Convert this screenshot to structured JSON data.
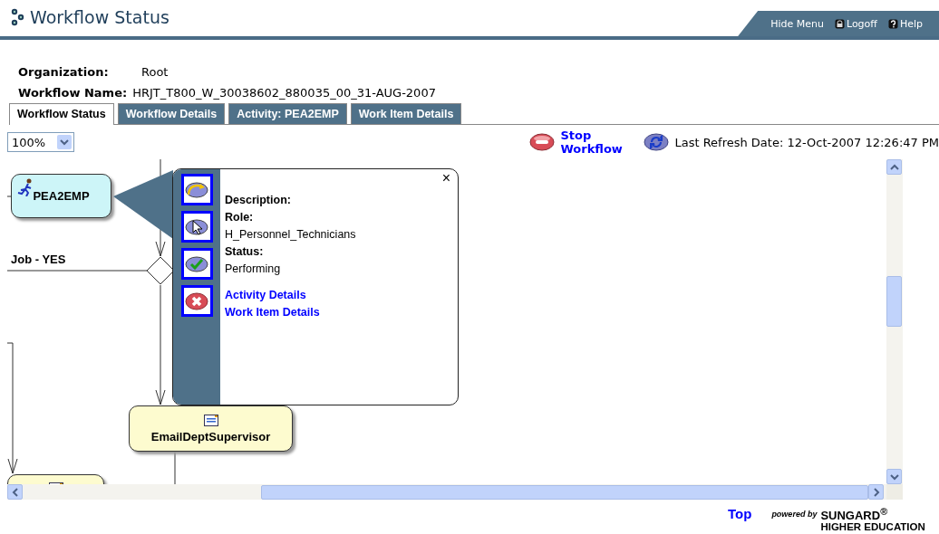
{
  "header": {
    "title": "Workflow Status",
    "nav": [
      {
        "label": "Hide Menu"
      },
      {
        "label": "Logoff",
        "kind": "lock"
      },
      {
        "label": "Help",
        "kind": "help"
      }
    ]
  },
  "info": [
    {
      "label": "Organization:",
      "value": "Root"
    },
    {
      "label": "Workflow Name:",
      "value": "HRJT_T800_W_30038602_880035_00_31-AUG-2007"
    }
  ],
  "tabs": [
    {
      "label": "Workflow Status",
      "selected": true
    },
    {
      "label": "Workflow Details",
      "selected": false
    },
    {
      "label": "Activity: PEA2EMP",
      "selected": false
    },
    {
      "label": "Work Item Details",
      "selected": false
    }
  ],
  "toolbar": {
    "zoom": "100%",
    "stop_label": "Stop Workflow",
    "refresh_label": "Last Refresh Date: 12-Oct-2007 12:26:47 PM"
  },
  "diagram": {
    "nodes": [
      {
        "label": "PEA2EMP",
        "kind": "activity"
      },
      {
        "label": "EmailDeptSupervisor",
        "kind": "email"
      },
      {
        "kind": "email"
      }
    ],
    "edge_label": "Job - YES",
    "popup": {
      "close": "×",
      "actions": [
        {
          "kind": "forward"
        },
        {
          "kind": "select"
        },
        {
          "kind": "complete"
        },
        {
          "kind": "cancel"
        }
      ],
      "fields": [
        {
          "label": "Description:"
        },
        {
          "label": "Role:",
          "value": "H_Personnel_Technicians"
        },
        {
          "label": "Status:",
          "value": "Performing"
        }
      ],
      "links": [
        "Activity Details",
        "Work Item Details"
      ]
    }
  },
  "footer": {
    "top_link": "Top",
    "powered_by": "powered by",
    "brand": "SUNGARD$^{®}$",
    "brand_sub": "HIGHER EDUCATION"
  }
}
